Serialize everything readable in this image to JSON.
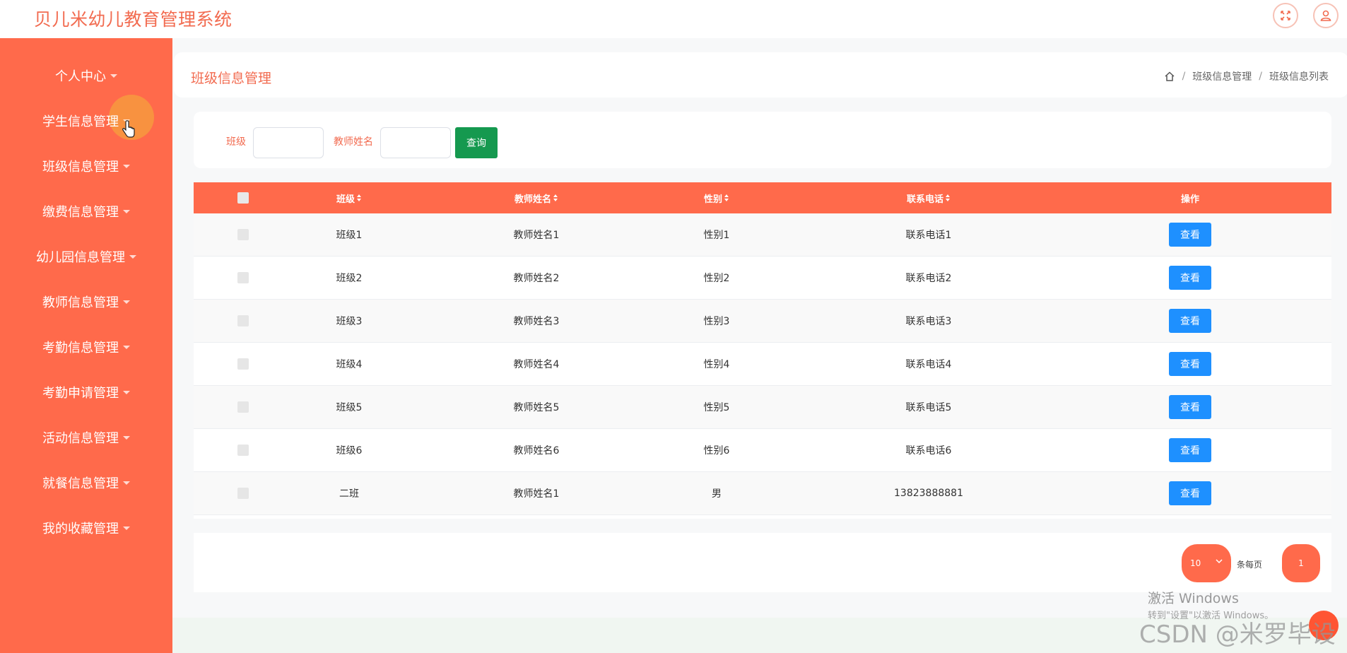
{
  "app": {
    "title": "贝儿米幼儿教育管理系统"
  },
  "header": {
    "icons": [
      "fullscreen-icon",
      "user-icon"
    ]
  },
  "sidebar": {
    "items": [
      {
        "label": "个人中心"
      },
      {
        "label": "学生信息管理"
      },
      {
        "label": "班级信息管理"
      },
      {
        "label": "缴费信息管理"
      },
      {
        "label": "幼儿园信息管理"
      },
      {
        "label": "教师信息管理"
      },
      {
        "label": "考勤信息管理"
      },
      {
        "label": "考勤申请管理"
      },
      {
        "label": "活动信息管理"
      },
      {
        "label": "就餐信息管理"
      },
      {
        "label": "我的收藏管理"
      }
    ]
  },
  "page": {
    "title": "班级信息管理",
    "breadcrumb": [
      "班级信息管理",
      "班级信息列表"
    ]
  },
  "search": {
    "class_label": "班级",
    "teacher_label": "教师姓名",
    "button": "查询"
  },
  "table": {
    "headers": [
      "班级",
      "教师姓名",
      "性别",
      "联系电话",
      "操作"
    ],
    "action_label": "查看",
    "rows": [
      [
        "班级1",
        "教师姓名1",
        "性别1",
        "联系电话1"
      ],
      [
        "班级2",
        "教师姓名2",
        "性别2",
        "联系电话2"
      ],
      [
        "班级3",
        "教师姓名3",
        "性别3",
        "联系电话3"
      ],
      [
        "班级4",
        "教师姓名4",
        "性别4",
        "联系电话4"
      ],
      [
        "班级5",
        "教师姓名5",
        "性别5",
        "联系电话5"
      ],
      [
        "班级6",
        "教师姓名6",
        "性别6",
        "联系电话6"
      ],
      [
        "二班",
        "教师姓名1",
        "男",
        "13823888881"
      ]
    ]
  },
  "pagination": {
    "page_size": "10",
    "per_page_label": "条每页",
    "current_page": "1"
  },
  "overlay": {
    "activate_title": "激活 Windows",
    "activate_sub": "转到\"设置\"以激活 Windows。",
    "csdn": "CSDN @米罗毕设"
  },
  "colors": {
    "accent": "#ff6a4b",
    "brand_text": "#f26b50",
    "view_button": "#1e90ff",
    "search_button": "#15994f"
  }
}
